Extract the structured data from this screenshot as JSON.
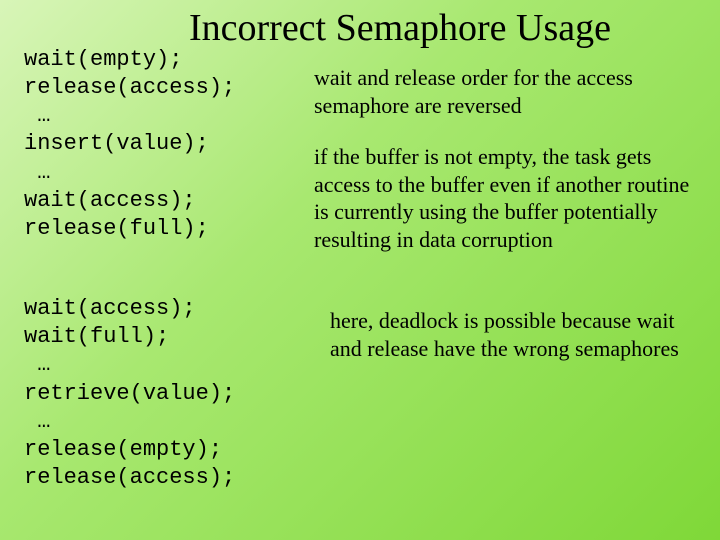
{
  "title": "Incorrect Semaphore Usage",
  "code": {
    "block1": "wait(empty);\nrelease(access);\n …\ninsert(value);\n …\nwait(access);\nrelease(full);",
    "block2": "wait(access);\nwait(full);\n …\nretrieve(value);\n …\nrelease(empty);\nrelease(access);"
  },
  "explain": {
    "p1": "wait and release order for the access semaphore are reversed",
    "p2": "if the buffer is not empty, the task gets access to the buffer even if another routine is currently using the buffer potentially resulting in data corruption",
    "p3": "here, deadlock is possible because wait and release have the wrong semaphores"
  }
}
